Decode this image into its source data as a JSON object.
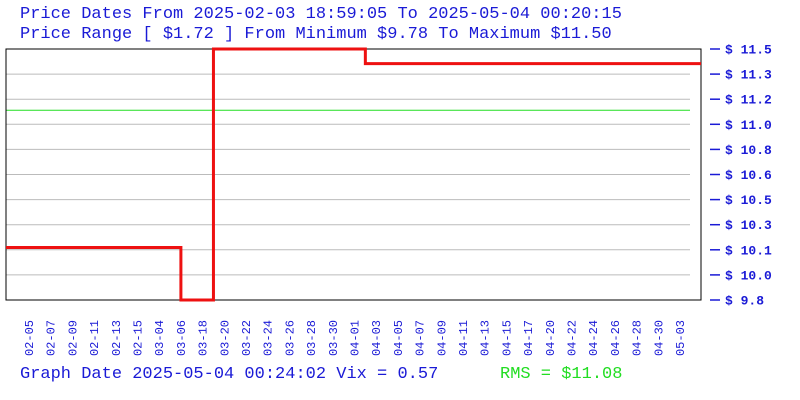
{
  "header": {
    "line1": "Price Dates From 2025-02-03 18:59:05 To 2025-05-04 00:20:15",
    "line2": "Price Range [ $1.72 ] From Minimum $9.78 To Maximum $11.50"
  },
  "footer": {
    "graph_date": "Graph Date 2025-05-04 00:24:02 Vix = 0.57",
    "rms": "RMS = $11.08"
  },
  "colors": {
    "text": "#1a1ad6",
    "price_line": "#ee1111",
    "rms_line": "#22dd22",
    "grid": "#bbbbbb"
  },
  "chart_data": {
    "type": "line",
    "ylim": [
      9.78,
      11.5
    ],
    "y_tick_labels": [
      "$ 11.5",
      "$ 11.3",
      "$ 11.2",
      "$ 11.0",
      "$ 10.8",
      "$ 10.6",
      "$ 10.5",
      "$ 10.3",
      "$ 10.1",
      "$ 10.0",
      "$ 9.8"
    ],
    "x_tick_labels": [
      "02-05",
      "02-07",
      "02-09",
      "02-11",
      "02-13",
      "02-15",
      "03-04",
      "03-06",
      "03-18",
      "03-20",
      "03-22",
      "03-24",
      "03-26",
      "03-28",
      "03-30",
      "04-01",
      "04-03",
      "04-05",
      "04-07",
      "04-09",
      "04-11",
      "04-13",
      "04-15",
      "04-17",
      "04-20",
      "04-22",
      "04-24",
      "04-26",
      "04-28",
      "04-30",
      "05-03"
    ],
    "rms": 11.08,
    "grid": true,
    "series": [
      {
        "step": true,
        "x": [
          0,
          7,
          8.5,
          15.5,
          32
        ],
        "y": [
          10.14,
          9.78,
          11.5,
          11.4,
          11.4
        ]
      }
    ]
  }
}
